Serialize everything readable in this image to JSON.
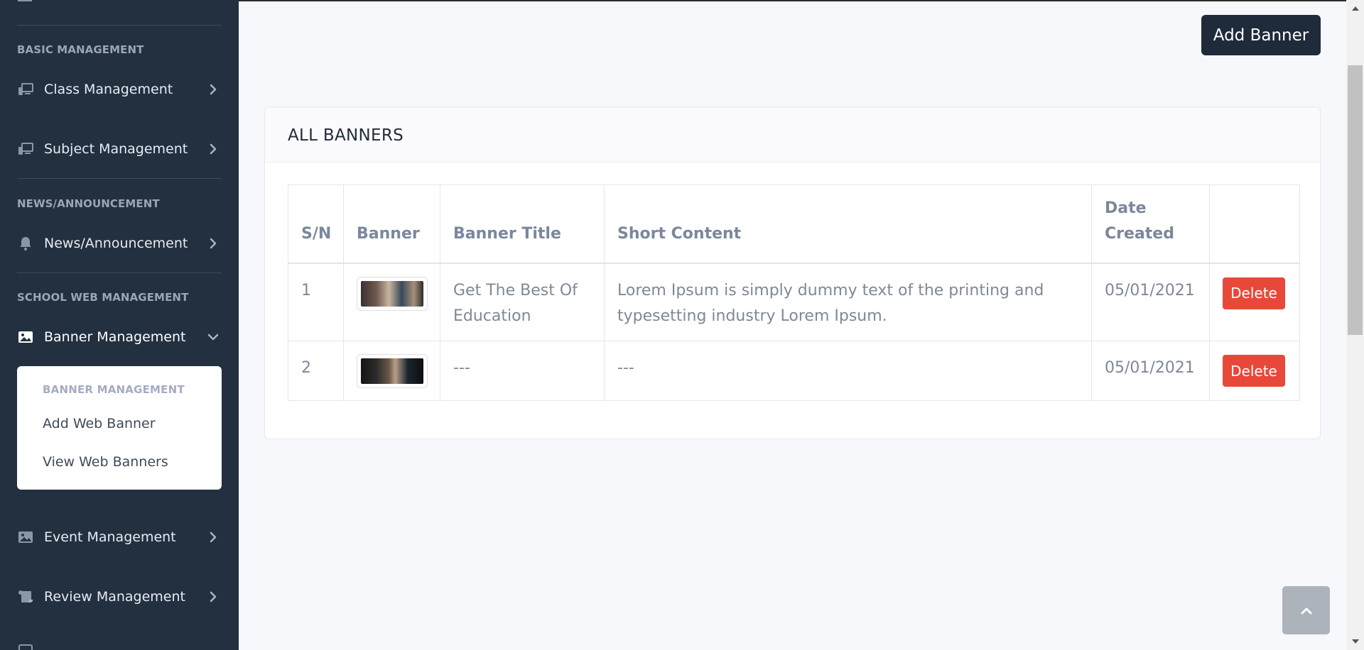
{
  "sidebar": {
    "sections": {
      "basic": "BASIC MANAGEMENT",
      "news": "NEWS/ANNOUNCEMENT",
      "school_web": "SCHOOL WEB MANAGEMENT"
    },
    "items": {
      "class": "Class Management",
      "subject": "Subject Management",
      "news": "News/Announcement",
      "banner": "Banner Management",
      "event": "Event Management",
      "review": "Review Management"
    },
    "submenu": {
      "heading": "BANNER MANAGEMENT",
      "links": [
        "Add Web Banner",
        "View Web Banners"
      ]
    }
  },
  "header": {
    "add_banner_label": "Add Banner"
  },
  "card": {
    "title": "ALL BANNERS"
  },
  "table": {
    "columns": [
      "S/N",
      "Banner",
      "Banner Title",
      "Short Content",
      "Date Created",
      ""
    ],
    "rows": [
      {
        "sn": "1",
        "title": "Get The Best Of Education",
        "content": "Lorem Ipsum is simply dummy text of the printing and typesetting industry Lorem Ipsum.",
        "date": "05/01/2021",
        "action": "Delete"
      },
      {
        "sn": "2",
        "title": "---",
        "content": "---",
        "date": "05/01/2021",
        "action": "Delete"
      }
    ]
  },
  "colors": {
    "sidebar_bg": "#233040",
    "primary_button": "#1f2b3a",
    "delete_button": "#e8483a",
    "page_bg": "#f7f8fb"
  },
  "icons": [
    "desktop-icon",
    "bell-icon",
    "image-icon",
    "scroll-icon",
    "chevron-right-icon",
    "chevron-down-icon",
    "arrow-up-icon"
  ]
}
